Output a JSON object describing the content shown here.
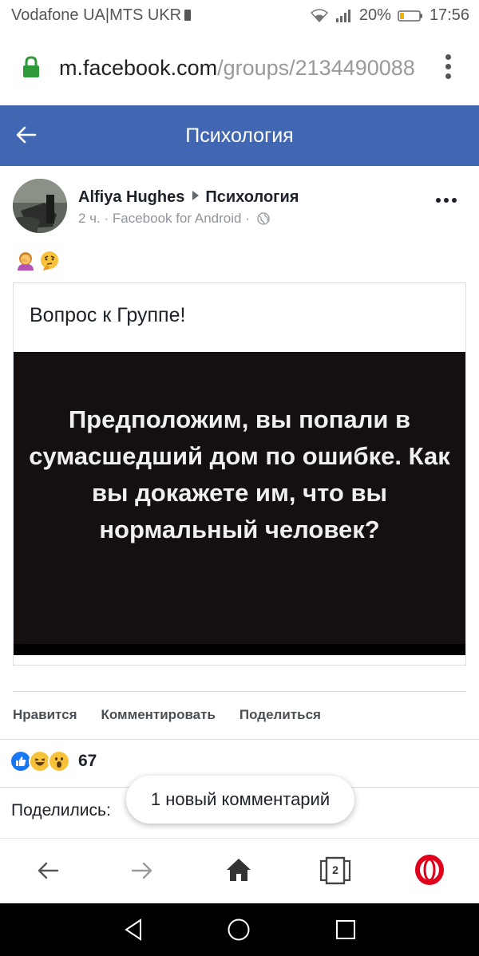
{
  "status_bar": {
    "carrier": "Vodafone UA|MTS UKR",
    "battery": "20%",
    "time": "17:56"
  },
  "browser": {
    "url_domain": "m.facebook.com",
    "url_path": "/groups/2134490088",
    "tab_count": "2"
  },
  "header": {
    "title": "Психология"
  },
  "post": {
    "author": "Alfiya Hughes",
    "group": "Психология",
    "meta": "2 ч. · Facebook for Android ·",
    "card_caption": "Вопрос к Группе!",
    "image_text": "Предположим, вы попали в сумасшедший дом по ошибке. Как вы докажете им, что вы нормальный человек?"
  },
  "actions": {
    "like": "Нравится",
    "comment": "Комментировать",
    "share": "Поделиться"
  },
  "reactions": {
    "count": "67"
  },
  "shares": {
    "label": "Поделились: "
  },
  "new_comment_toast": "1 новый комментарий",
  "colors": {
    "facebook_blue": "#4267b2",
    "opera_red": "#e0001b"
  }
}
